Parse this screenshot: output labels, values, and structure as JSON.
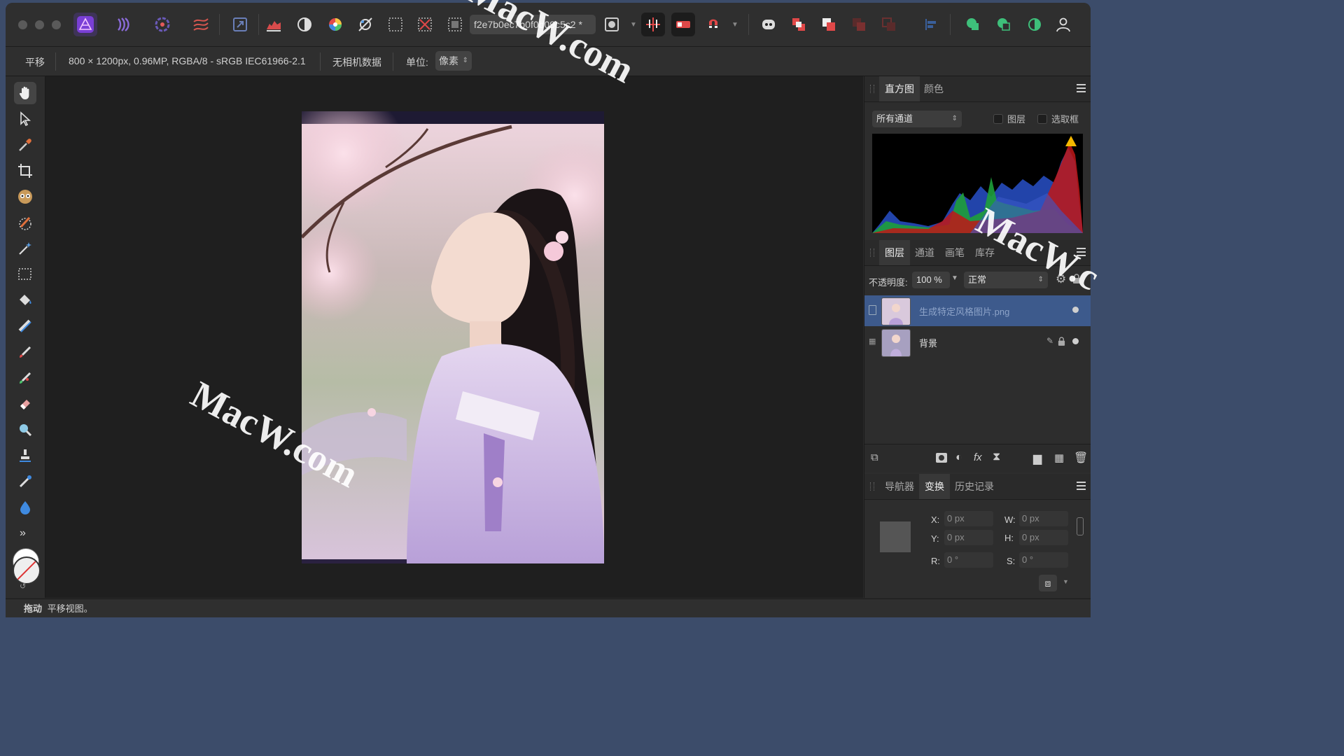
{
  "document": {
    "name": "f2e7b0ec7b0f0b09c5c2",
    "modified_marker": "*"
  },
  "context_bar": {
    "tool_name": "平移",
    "image_info": "800 × 1200px, 0.96MP, RGBA/8 - sRGB IEC61966-2.1",
    "camera_info": "无相机数据",
    "unit_label": "单位:",
    "unit_value": "像素"
  },
  "histogram_panel": {
    "tabs": [
      "直方图",
      "颜色"
    ],
    "channel_select": "所有通道",
    "checkbox_layer": "图层",
    "checkbox_marquee": "选取框"
  },
  "layers_panel": {
    "tabs": [
      "图层",
      "通道",
      "画笔",
      "库存"
    ],
    "opacity_label": "不透明度:",
    "opacity_value": "100 %",
    "blend_mode": "正常",
    "layers": [
      {
        "name": "生成特定风格图片.png",
        "selected": true
      },
      {
        "name": "背景",
        "selected": false
      }
    ]
  },
  "transform_panel": {
    "tabs": [
      "导航器",
      "变换",
      "历史记录"
    ],
    "x_label": "X:",
    "x_value": "0 px",
    "y_label": "Y:",
    "y_value": "0 px",
    "w_label": "W:",
    "w_value": "0 px",
    "h_label": "H:",
    "h_value": "0 px",
    "r_label": "R:",
    "r_value": "0 °",
    "s_label": "S:",
    "s_value": "0 °"
  },
  "status_bar": {
    "bold": "拖动",
    "text": "平移视图。"
  },
  "watermarks": [
    "MacW.com",
    "MacW.com",
    "MacW.c"
  ],
  "colors": {
    "accent_blue": "#3d5a8c",
    "affinity_purple": "#7a3fd6"
  }
}
